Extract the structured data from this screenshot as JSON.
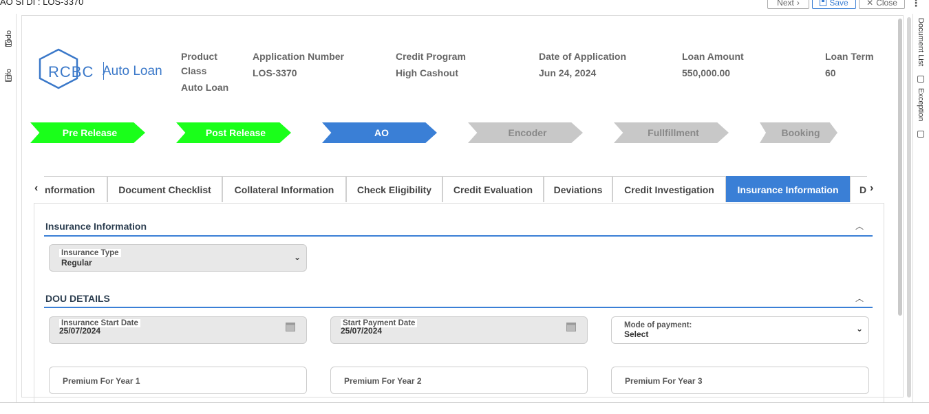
{
  "window": {
    "title": "AO SI DI : LOS-3370"
  },
  "topbar": {
    "next_label": "Next",
    "save_label": "Save",
    "close_label": "Close"
  },
  "left_rail": {
    "todo_label": "Todo",
    "info_label": "Info"
  },
  "right_rail": {
    "doclist_label": "Document List",
    "exception_label": "Exception"
  },
  "logo": {
    "brand": "RCBC",
    "product": "Auto Loan"
  },
  "header": {
    "product_class_label": "Product Class",
    "product_class_value": "Auto Loan",
    "application_number_label": "Application Number",
    "application_number_value": "LOS-3370",
    "credit_program_label": "Credit Program",
    "credit_program_value": "High Cashout",
    "date_label": "Date of Application",
    "date_value": "Jun 24, 2024",
    "loan_amount_label": "Loan Amount",
    "loan_amount_value": "550,000.00",
    "loan_term_label": "Loan Term",
    "loan_term_value": "60"
  },
  "steps": [
    {
      "label": "Pre Release",
      "state": "done"
    },
    {
      "label": "Post Release",
      "state": "done"
    },
    {
      "label": "AO",
      "state": "current"
    },
    {
      "label": "Encoder",
      "state": "pending"
    },
    {
      "label": "Fullfillment",
      "state": "pending"
    },
    {
      "label": "Booking",
      "state": "pending"
    }
  ],
  "tabs": [
    "nformation",
    "Document Checklist",
    "Collateral Information",
    "Check Eligibility",
    "Credit Evaluation",
    "Deviations",
    "Credit Investigation",
    "Insurance Information",
    "D"
  ],
  "active_tab": "Insurance Information",
  "insurance_section": {
    "title": "Insurance Information",
    "insurance_type_label": "Insurance Type",
    "insurance_type_value": "Regular"
  },
  "dou_section": {
    "title": "DOU DETAILS",
    "start_date_label": "Insurance Start Date",
    "start_date_value": "25/07/2024",
    "payment_date_label": "Start Payment Date",
    "payment_date_value": "25/07/2024",
    "mode_label": "Mode of payment:",
    "mode_value": "Select",
    "premium1_placeholder": "Premium For Year 1",
    "premium2_placeholder": "Premium For Year 2",
    "premium3_placeholder": "Premium For Year 3"
  },
  "colors": {
    "accent": "#3a7fd6",
    "done": "#1aff1a",
    "pending": "#c8c8c8"
  }
}
